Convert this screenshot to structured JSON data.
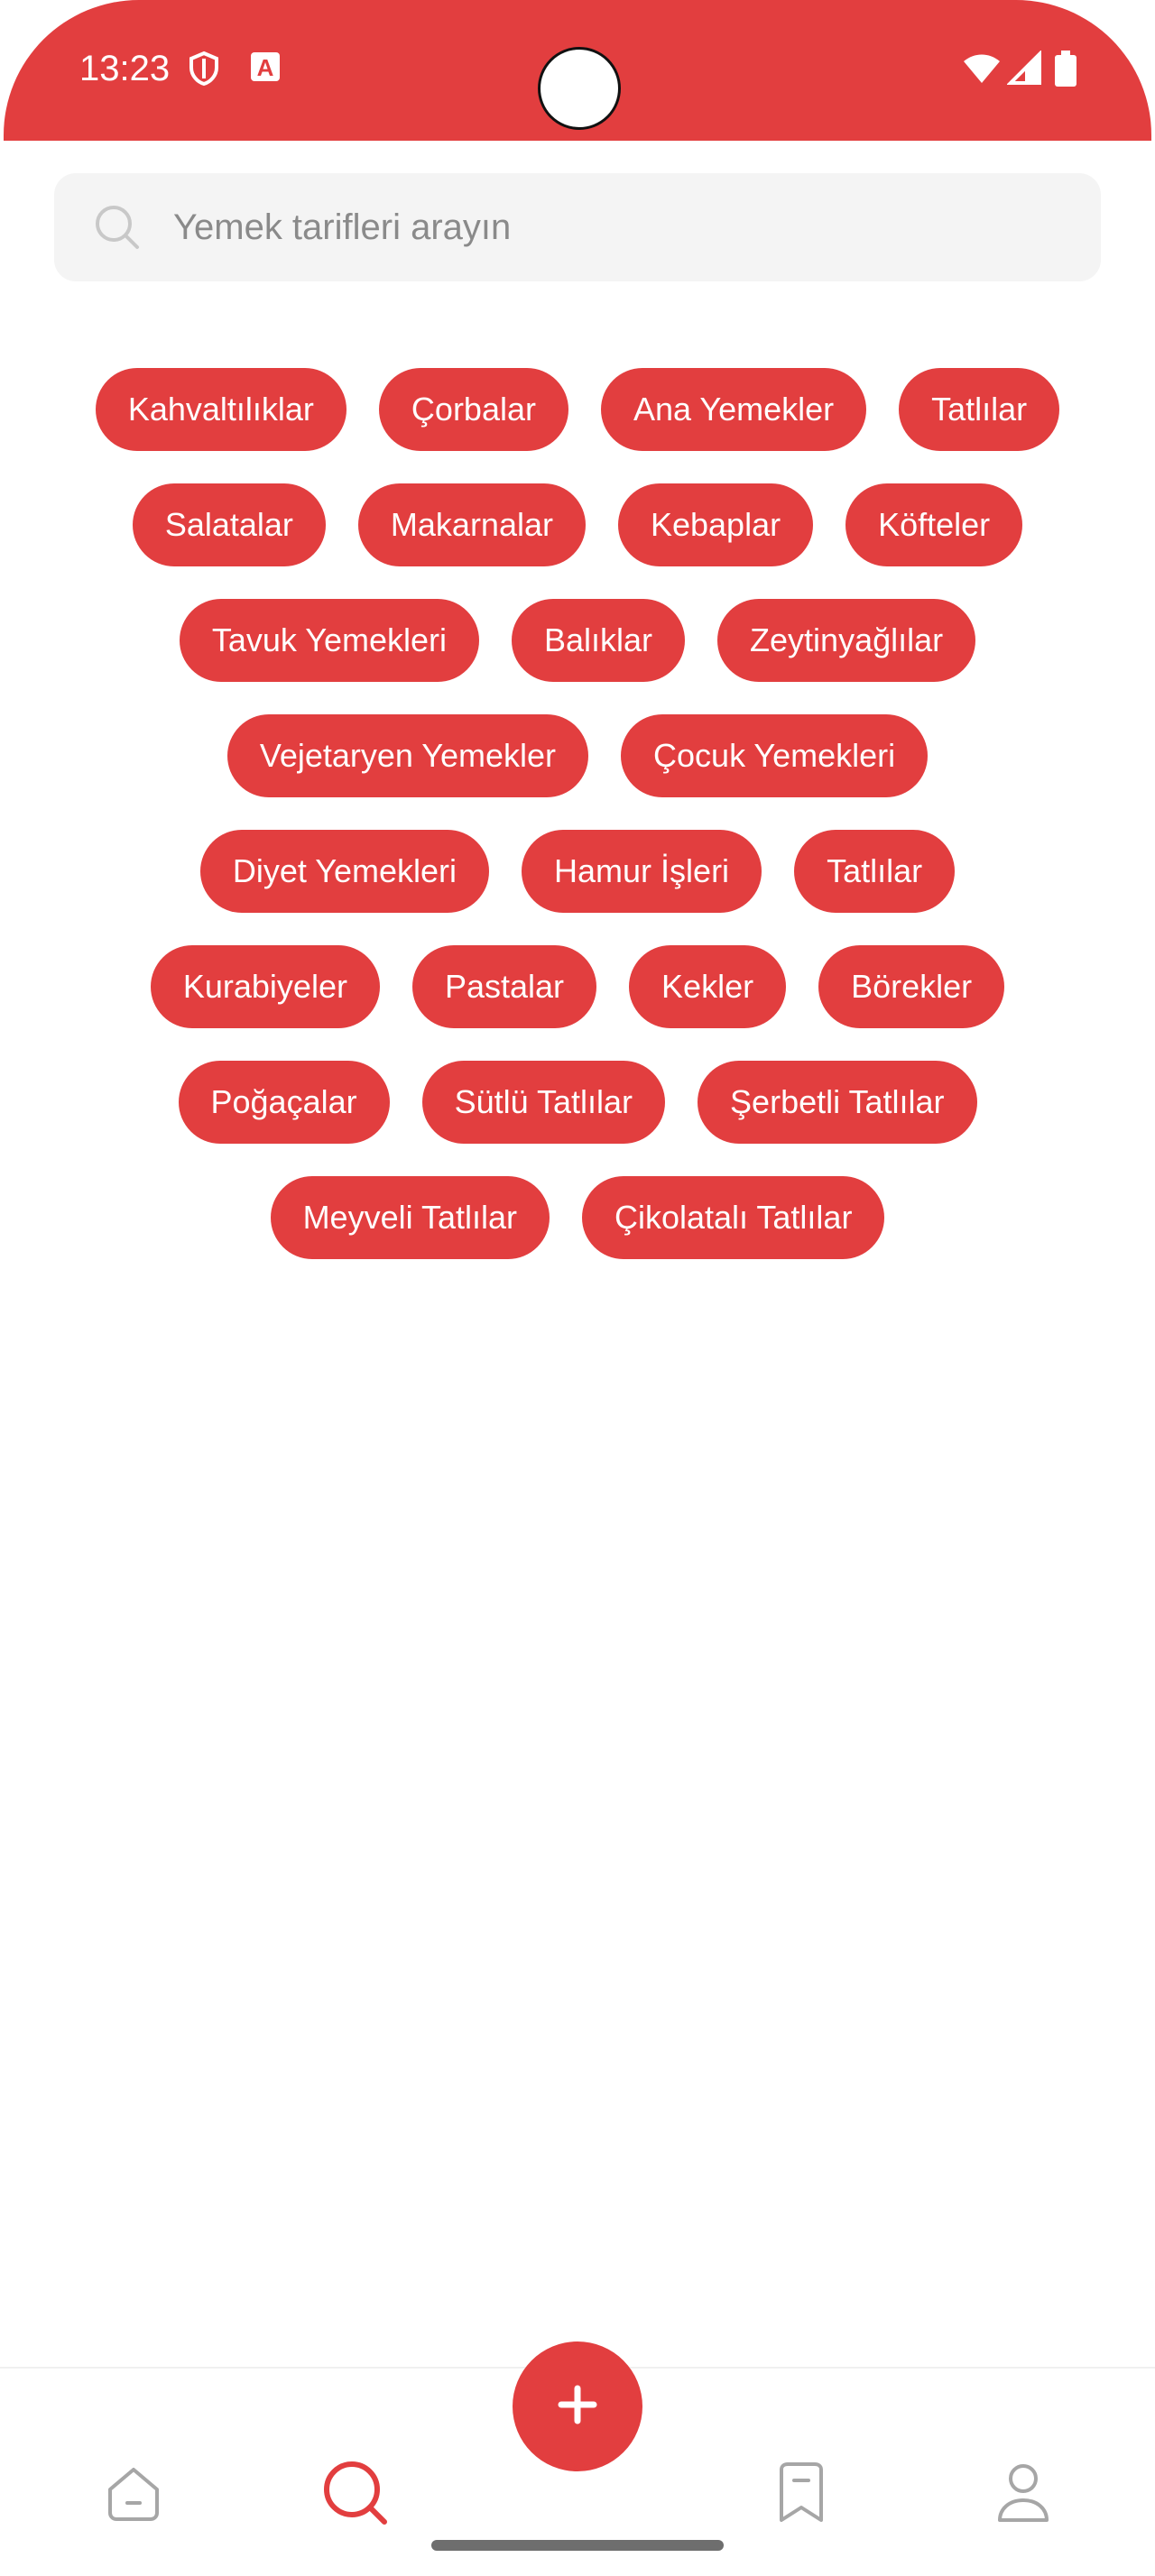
{
  "status_bar": {
    "time": "13:23",
    "icons": [
      "shield-icon",
      "app-notification-icon",
      "wifi-icon",
      "signal-icon",
      "battery-icon"
    ],
    "app_notification_glyph": "A"
  },
  "search": {
    "placeholder": "Yemek tarifleri arayın"
  },
  "categories": {
    "rows": [
      [
        "Kahvaltılıklar",
        "Çorbalar",
        "Ana Yemekler",
        "Tatlılar"
      ],
      [
        "Salatalar",
        "Makarnalar",
        "Kebaplar",
        "Köfteler"
      ],
      [
        "Tavuk Yemekleri",
        "Balıklar",
        "Zeytinyağlılar"
      ],
      [
        "Vejetaryen Yemekler",
        "Çocuk Yemekleri"
      ],
      [
        "Diyet Yemekleri",
        "Hamur İşleri",
        "Tatlılar"
      ],
      [
        "Kurabiyeler",
        "Pastalar",
        "Kekler",
        "Börekler"
      ],
      [
        "Poğaçalar",
        "Sütlü Tatlılar",
        "Şerbetli Tatlılar"
      ],
      [
        "Meyveli Tatlılar",
        "Çikolatalı Tatlılar"
      ]
    ]
  },
  "bottom_nav": {
    "items": [
      {
        "icon": "home-icon",
        "active": false
      },
      {
        "icon": "search-icon",
        "active": true
      },
      {
        "icon": "add-icon",
        "active": false
      },
      {
        "icon": "bookmark-icon",
        "active": false
      },
      {
        "icon": "profile-icon",
        "active": false
      }
    ]
  },
  "colors": {
    "accent": "#E23E3F",
    "chip_text": "#FFFFFF",
    "search_bg": "#F4F4F4",
    "placeholder": "#8A8A8A",
    "nav_inactive": "#9A9A9A"
  }
}
